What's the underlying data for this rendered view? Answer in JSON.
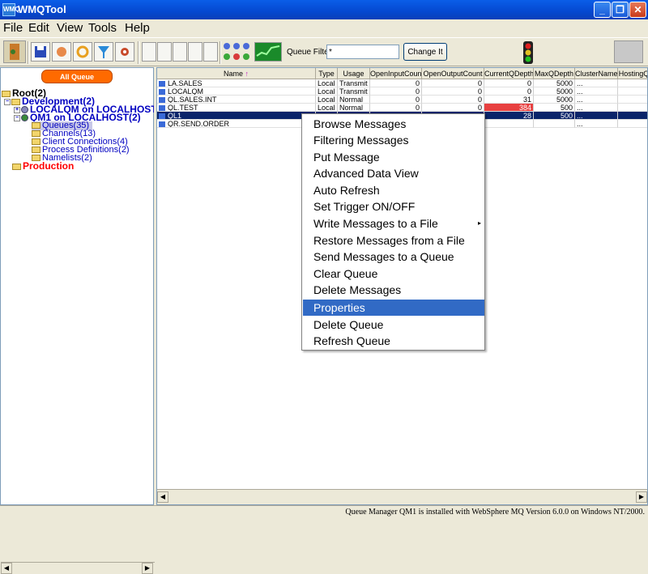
{
  "window": {
    "title": "WMQTool",
    "app_icon": "WMQ"
  },
  "menu": [
    "File",
    "Edit",
    "View",
    "Tools",
    "Help"
  ],
  "toolbar": {
    "queue_filter_label": "Queue Filter:",
    "queue_filter_value": "*",
    "change_button": "Change It"
  },
  "left": {
    "all_qm_button": "All Queue Managers",
    "tree": {
      "root": "Root(2)",
      "development": "Development(2)",
      "localqm": "LOCALQM on LOCALHOST(",
      "qm1": "QM1 on LOCALHOST(2)",
      "queues": "Queues(35)",
      "channels": "Channels(13)",
      "client_connections": "Client Connections(4)",
      "process_definitions": "Process Definitions(2)",
      "namelists": "Namelists(2)",
      "production": "Production"
    }
  },
  "grid": {
    "columns": [
      "Name",
      "Type",
      "Usage",
      "OpenInputCount",
      "OpenOutputCount",
      "CurrentQDepth",
      "MaxQDepth",
      "ClusterName",
      "HostingQ"
    ],
    "rows": [
      {
        "name": "LA.SALES",
        "type": "Local",
        "usage": "Transmit",
        "in": "0",
        "out": "0",
        "depth": "0",
        "max": "5000",
        "cluster": "..."
      },
      {
        "name": "LOCALQM",
        "type": "Local",
        "usage": "Transmit",
        "in": "0",
        "out": "0",
        "depth": "0",
        "max": "5000",
        "cluster": "..."
      },
      {
        "name": "QL.SALES.INT",
        "type": "Local",
        "usage": "Normal",
        "in": "0",
        "out": "0",
        "depth": "31",
        "max": "5000",
        "cluster": "..."
      },
      {
        "name": "QL.TEST",
        "type": "Local",
        "usage": "Normal",
        "in": "0",
        "out": "0",
        "depth": "384",
        "max": "500",
        "cluster": "..."
      },
      {
        "name": "QL1",
        "type": "",
        "usage": "",
        "in": "",
        "out": "",
        "depth": "28",
        "max": "500",
        "cluster": "..."
      },
      {
        "name": "QR.SEND.ORDER",
        "type": "",
        "usage": "",
        "in": "",
        "out": "",
        "depth": "",
        "max": "",
        "cluster": "..."
      }
    ]
  },
  "context_menu": [
    "Browse Messages",
    "Filtering Messages",
    "Put Message",
    "Advanced Data View",
    "Auto Refresh",
    "Set Trigger ON/OFF",
    "Write Messages to a File",
    "Restore Messages from a File",
    "Send Messages to a Queue",
    "Clear Queue",
    "Delete Messages",
    "Properties",
    "Delete Queue",
    "Refresh Queue"
  ],
  "status": "Queue Manager QM1 is installed with WebSphere MQ Version 6.0.0 on Windows NT/2000.",
  "colors": {
    "title_bar": "#0548d0",
    "highlight": "#316ac5",
    "alert_cell": "#e84040",
    "root_tree": "#000080",
    "production": "#ff0000"
  }
}
